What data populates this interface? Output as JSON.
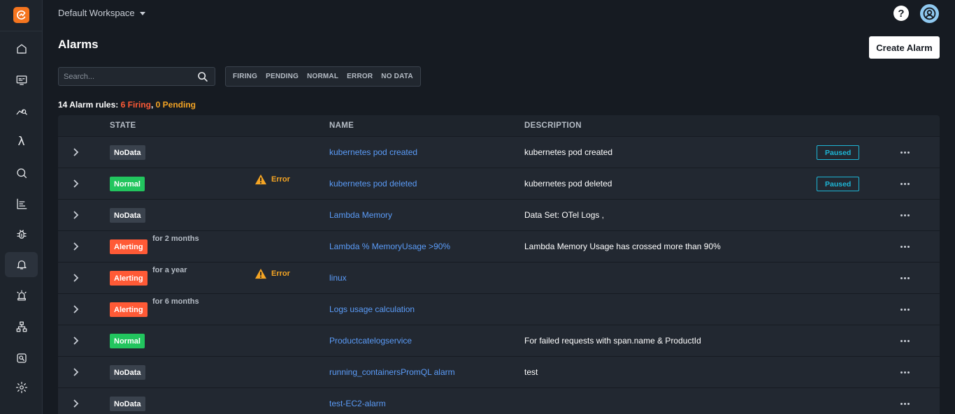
{
  "header": {
    "workspace": "Default Workspace",
    "help_label": "?"
  },
  "page": {
    "title": "Alarms",
    "create_button": "Create Alarm"
  },
  "search": {
    "placeholder": "Search..."
  },
  "filters": [
    "FIRING",
    "PENDING",
    "NORMAL",
    "ERROR",
    "NO DATA"
  ],
  "summary": {
    "prefix": "14 Alarm rules:",
    "firing": "6 Firing",
    "separator": ",",
    "pending": "0 Pending"
  },
  "table": {
    "columns": {
      "state": "STATE",
      "name": "NAME",
      "description": "DESCRIPTION"
    },
    "rows": [
      {
        "state": "NoData",
        "state_kind": "nodata",
        "since": "",
        "error": "",
        "name": "kubernetes pod created",
        "description": "kubernetes pod created",
        "paused": "Paused"
      },
      {
        "state": "Normal",
        "state_kind": "normal",
        "since": "",
        "error": "Error",
        "name": "kubernetes pod deleted",
        "description": "kubernetes pod deleted",
        "paused": "Paused"
      },
      {
        "state": "NoData",
        "state_kind": "nodata",
        "since": "",
        "error": "",
        "name": "Lambda Memory",
        "description": "Data Set: OTel Logs ,",
        "paused": ""
      },
      {
        "state": "Alerting",
        "state_kind": "alerting",
        "since": "for 2 months",
        "error": "",
        "name": "Lambda % MemoryUsage >90%",
        "description": "Lambda Memory Usage has crossed more than 90%",
        "paused": ""
      },
      {
        "state": "Alerting",
        "state_kind": "alerting",
        "since": "for a year",
        "error": "Error",
        "name": "linux",
        "description": "",
        "paused": ""
      },
      {
        "state": "Alerting",
        "state_kind": "alerting",
        "since": "for 6 months",
        "error": "",
        "name": "Logs usage calculation",
        "description": "",
        "paused": ""
      },
      {
        "state": "Normal",
        "state_kind": "normal",
        "since": "",
        "error": "",
        "name": "Productcatelogservice",
        "description": "For failed requests with span.name & ProductId",
        "paused": ""
      },
      {
        "state": "NoData",
        "state_kind": "nodata",
        "since": "",
        "error": "",
        "name": "running_containersPromQL alarm",
        "description": "test",
        "paused": ""
      },
      {
        "state": "NoData",
        "state_kind": "nodata",
        "since": "",
        "error": "",
        "name": "test-EC2-alarm",
        "description": "",
        "paused": ""
      }
    ]
  },
  "sidebar": {
    "items": [
      {
        "name": "home-icon"
      },
      {
        "name": "dashboard-icon"
      },
      {
        "name": "explore-icon"
      },
      {
        "name": "lambda-icon",
        "label": "λ"
      },
      {
        "name": "search-icon"
      },
      {
        "name": "logs-icon"
      },
      {
        "name": "bug-icon"
      },
      {
        "name": "bell-icon",
        "active": true
      },
      {
        "name": "siren-icon"
      },
      {
        "name": "service-map-icon"
      },
      {
        "name": "synthetics-icon"
      },
      {
        "name": "gear-icon"
      }
    ]
  },
  "colors": {
    "firing": "#ff5a36",
    "pending": "#f5a524",
    "normal": "#22c55e",
    "link": "#5b9cf8",
    "paused": "#1eb6d6",
    "brand": "#f5751f"
  }
}
